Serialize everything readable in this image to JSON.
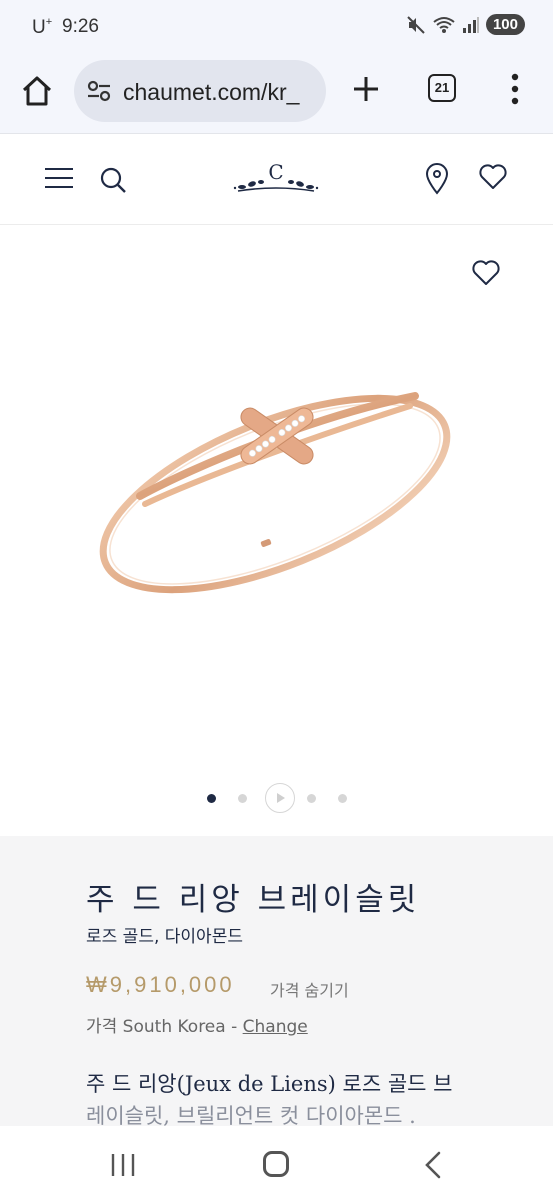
{
  "status_bar": {
    "carrier": "U",
    "carrier_sup": "+",
    "time": "9:26",
    "battery": "100",
    "icons": [
      "mute-icon",
      "wifi-icon",
      "signal-icon"
    ]
  },
  "browser": {
    "url": "chaumet.com/kr_",
    "tab_count": "21",
    "icons": [
      "home-icon",
      "site-settings-icon",
      "new-tab-icon",
      "more-icon"
    ]
  },
  "site_header": {
    "logo_letter": "C",
    "icons": [
      "menu-icon",
      "search-icon",
      "store-locator-icon",
      "wishlist-icon"
    ]
  },
  "gallery": {
    "slide_count": 4,
    "active_slide": 1,
    "has_video": true
  },
  "product": {
    "title": "주 드 리앙 브레이슬릿",
    "subtitle": "로즈 골드, 다이아몬드",
    "price": "₩9,910,000",
    "hide_price_label": "가격 숨기기",
    "country_prefix": "가격 South Korea - ",
    "change_label": "Change",
    "description_line1": "주 드 리앙(Jeux de Liens) 로즈 골드 브",
    "description_line2": "레이슬릿, 브릴리언트 컷 다이아몬드 ."
  },
  "colors": {
    "navy": "#1f2a44",
    "gold_price": "#b59a6a",
    "rose_gold": "#e3b28f"
  }
}
